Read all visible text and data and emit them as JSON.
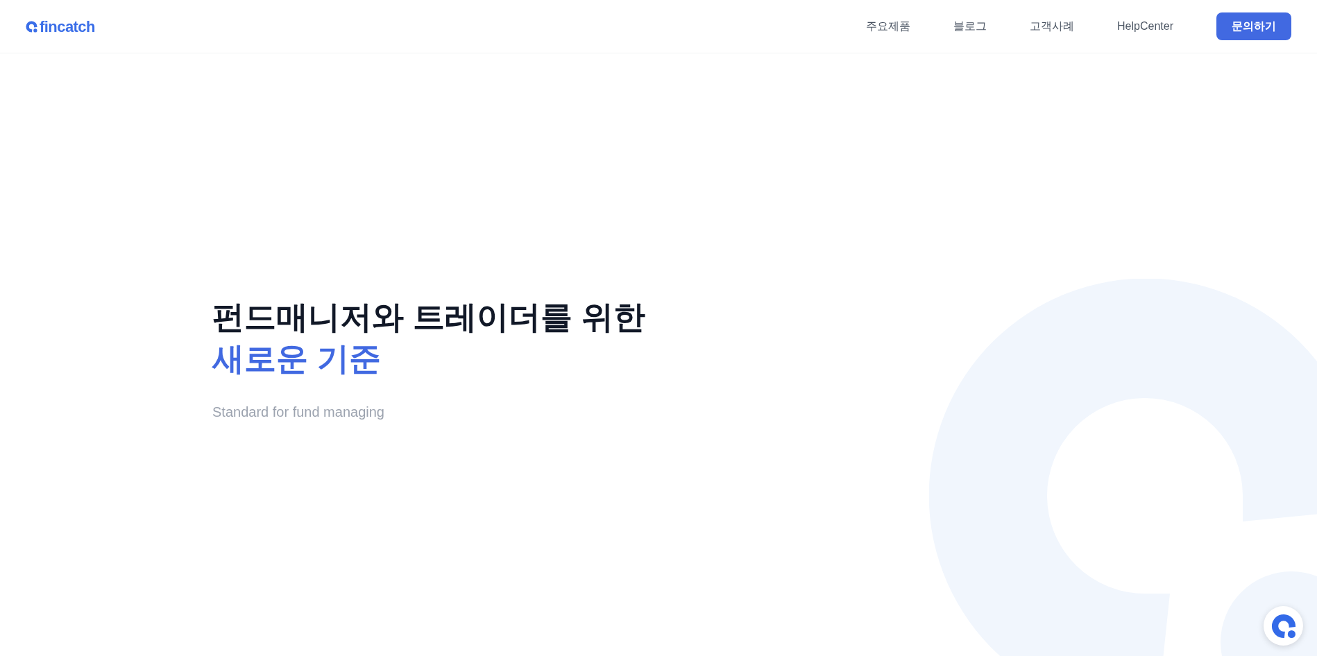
{
  "header": {
    "logo": "fincatch",
    "nav": [
      "주요제품",
      "블로그",
      "고객사례",
      "HelpCenter"
    ],
    "cta": "문의하기"
  },
  "hero": {
    "title": "펀드매니저와 트레이더를 위한",
    "highlight": "새로운 기준",
    "subtitle": "Standard for fund managing"
  }
}
